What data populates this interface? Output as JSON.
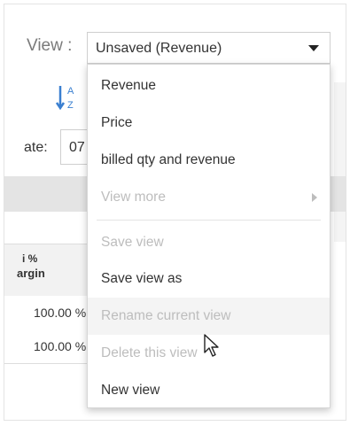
{
  "toolbar": {
    "view_label": "View :",
    "view_select_value": "Unsaved (Revenue)"
  },
  "background": {
    "date_label": "ate:",
    "date_value": "07",
    "column_header_line1": "i %",
    "column_header_line2": "argin",
    "rows": [
      "100.00 %",
      "100.00 %"
    ]
  },
  "menu": {
    "items": [
      {
        "label": "Revenue",
        "disabled": false
      },
      {
        "label": "Price",
        "disabled": false
      },
      {
        "label": "billed qty and revenue",
        "disabled": false
      },
      {
        "label": "View more",
        "disabled": true,
        "submenu": true
      },
      {
        "label": "Save view",
        "disabled": true
      },
      {
        "label": "Save view as",
        "disabled": false
      },
      {
        "label": "Rename current view",
        "disabled": true,
        "hovered": true
      },
      {
        "label": "Delete this view",
        "disabled": true
      },
      {
        "label": "New view",
        "disabled": false
      }
    ]
  },
  "colors": {
    "accent_blue": "#3a7fd0",
    "disabled_text": "#bdbdbd",
    "hover_bg": "#f4f4f4"
  }
}
